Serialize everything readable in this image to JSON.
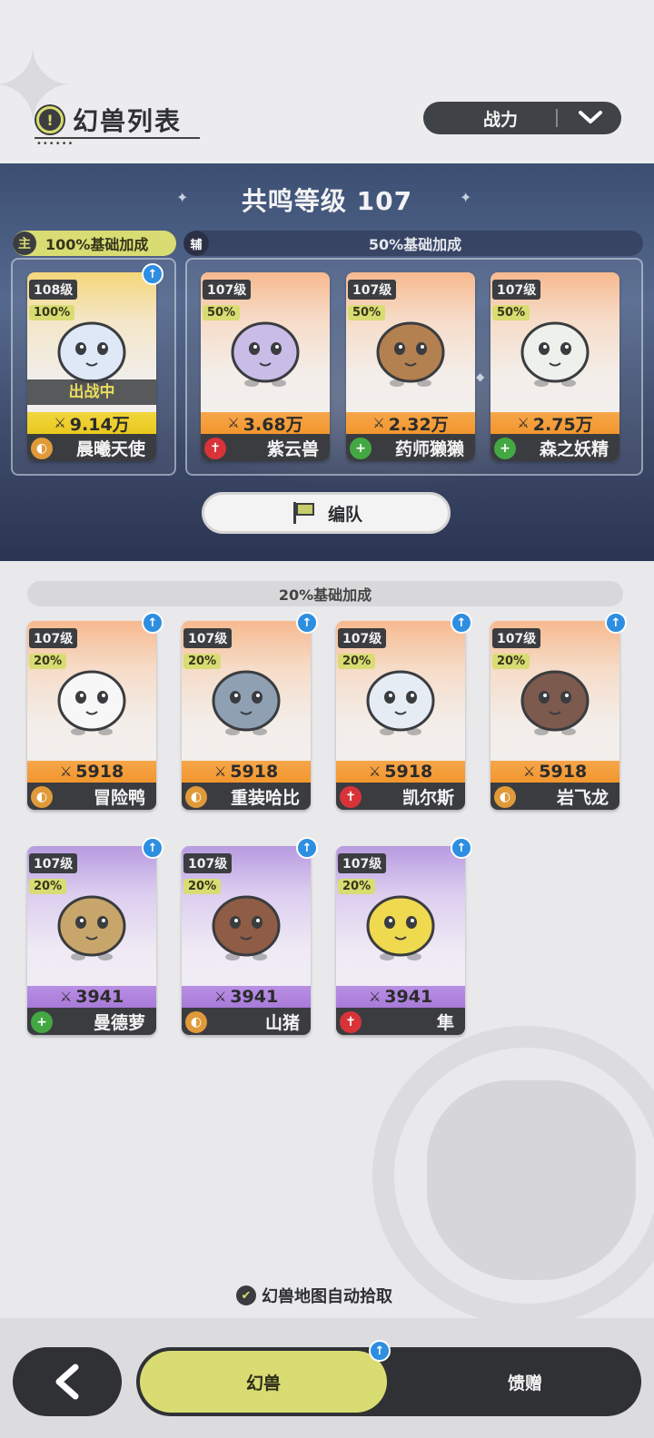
{
  "header": {
    "title": "幻兽列表",
    "title_icon": "exclamation-icon",
    "sort": {
      "selected": "战力"
    }
  },
  "resonance": {
    "title": "共鸣等级 107",
    "main_badge": "主",
    "main_bonus": "100%基础加成",
    "support_badge": "辅",
    "support_bonus": "50%基础加成",
    "formation_label": "编队"
  },
  "team": [
    {
      "level": "108级",
      "pct": "100%",
      "power": "9.14万",
      "name": "晨曦天使",
      "role": "defense",
      "status": "出战中",
      "upgrade": true,
      "rarity": "gold",
      "color": "#dfe8f7"
    },
    {
      "level": "107级",
      "pct": "50%",
      "power": "3.68万",
      "name": "紫云兽",
      "role": "attack",
      "upgrade": false,
      "rarity": "orange",
      "color": "#c9bde8"
    },
    {
      "level": "107级",
      "pct": "50%",
      "power": "2.32万",
      "name": "药师獭獭",
      "role": "heal",
      "upgrade": false,
      "rarity": "orange",
      "color": "#b3804f"
    },
    {
      "level": "107级",
      "pct": "50%",
      "power": "2.75万",
      "name": "森之妖精",
      "role": "heal",
      "upgrade": false,
      "rarity": "orange",
      "color": "#eef0ec"
    }
  ],
  "collection_bonus": "20%基础加成",
  "collection": [
    {
      "level": "107级",
      "pct": "20%",
      "power": "5918",
      "name": "冒险鸭",
      "role": "defense",
      "rarity": "orange",
      "color": "#f7f7f7"
    },
    {
      "level": "107级",
      "pct": "20%",
      "power": "5918",
      "name": "重装哈比",
      "role": "defense",
      "rarity": "orange",
      "color": "#8fa0b3"
    },
    {
      "level": "107级",
      "pct": "20%",
      "power": "5918",
      "name": "凯尔斯",
      "role": "attack",
      "rarity": "orange",
      "color": "#e6ecf4"
    },
    {
      "level": "107级",
      "pct": "20%",
      "power": "5918",
      "name": "岩飞龙",
      "role": "defense",
      "rarity": "orange",
      "color": "#7c5a4e"
    },
    {
      "level": "107级",
      "pct": "20%",
      "power": "3941",
      "name": "曼德萝",
      "role": "heal",
      "rarity": "purple",
      "color": "#c8a66b"
    },
    {
      "level": "107级",
      "pct": "20%",
      "power": "3941",
      "name": "山猪",
      "role": "defense",
      "rarity": "purple",
      "color": "#8f5c45"
    },
    {
      "level": "107级",
      "pct": "20%",
      "power": "3941",
      "name": "隼",
      "role": "attack",
      "rarity": "purple",
      "color": "#efd94e"
    }
  ],
  "auto_pick_label": "幻兽地图自动拾取",
  "nav": {
    "back_icon": "chevron-left-icon",
    "tab_active": "幻兽",
    "tab_gift": "馈赠"
  },
  "colors": {
    "accent": "#d9dc73",
    "dark": "#3a3c40",
    "upgrade_blue": "#2e8ee0"
  }
}
